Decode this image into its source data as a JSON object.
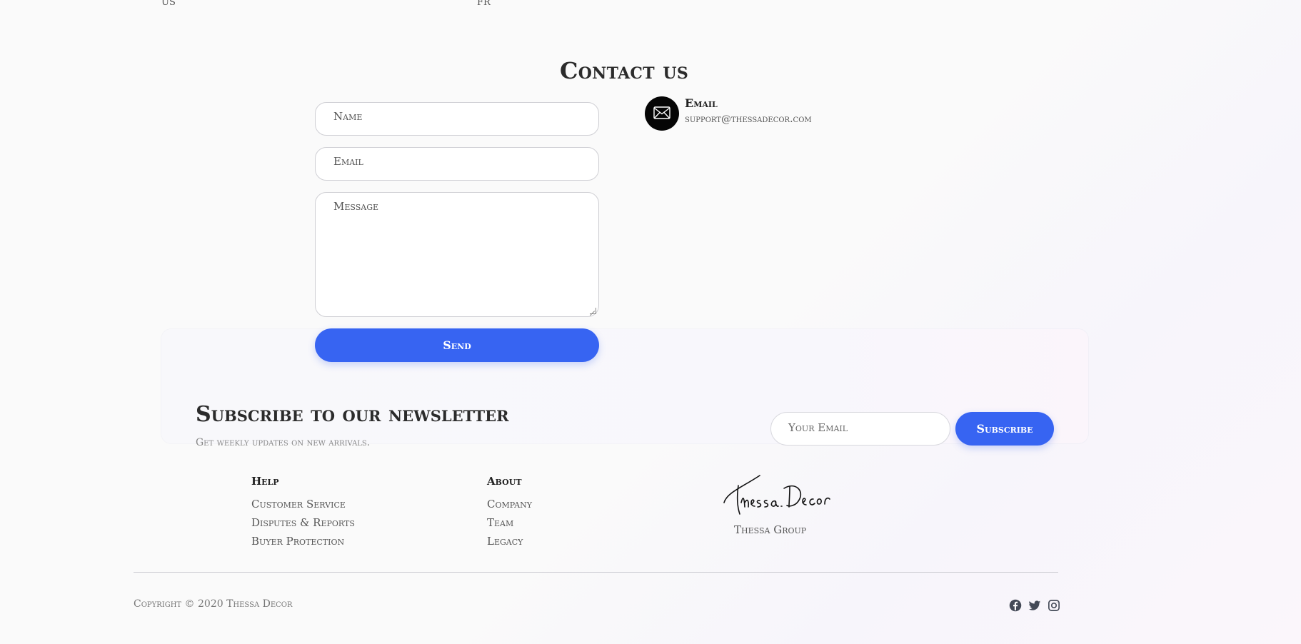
{
  "top_row": {
    "left_text": "US",
    "right_text": "FR"
  },
  "contact": {
    "title": "Contact us",
    "name_placeholder": "Name",
    "email_placeholder": "Email",
    "message_placeholder": "Message",
    "send_label": "Send",
    "email_label": "Email",
    "email_value": "support@thessadecor.com",
    "icon": "envelope-icon"
  },
  "newsletter": {
    "title": "Subscribe to our newsletter",
    "subtitle": "Get weekly updates on new arrivals.",
    "input_placeholder": "Your Email",
    "button_label": "Subscribe",
    "accent_color": "#3764f2"
  },
  "footer": {
    "help": {
      "heading": "Help",
      "links": [
        "Customer Service",
        "Disputes & Reports",
        "Buyer Protection"
      ]
    },
    "about": {
      "heading": "About",
      "links": [
        "Company",
        "Team",
        "Legacy"
      ]
    },
    "brand": {
      "logo_text": "Thessa Decor",
      "group": "Thessa Group"
    },
    "copyright": "Copyright © 2020 Thessa Decor",
    "social_icons": [
      "facebook-icon",
      "twitter-icon",
      "instagram-icon"
    ]
  }
}
